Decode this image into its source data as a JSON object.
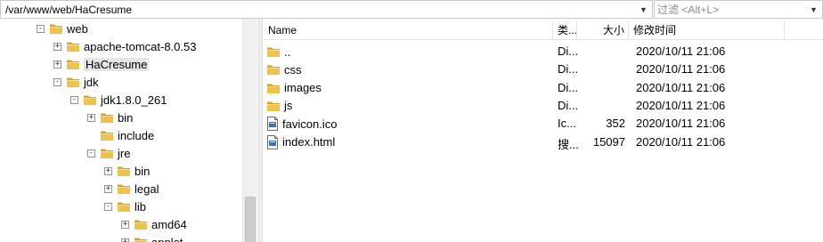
{
  "toolbar": {
    "path": "/var/www/web/HaCresume",
    "filter_placeholder": "过滤 <Alt+L>"
  },
  "tree": {
    "items": [
      {
        "label": "web",
        "expander": "-",
        "level": 2
      },
      {
        "label": "apache-tomcat-8.0.53",
        "expander": "+",
        "level": 3
      },
      {
        "label": "HaCresume",
        "expander": "+",
        "level": 3,
        "selected": true
      },
      {
        "label": "jdk",
        "expander": "-",
        "level": 3
      },
      {
        "label": "jdk1.8.0_261",
        "expander": "-",
        "level": 4
      },
      {
        "label": "bin",
        "expander": "+",
        "level": 5
      },
      {
        "label": "include",
        "expander": "",
        "level": 5
      },
      {
        "label": "jre",
        "expander": "-",
        "level": 5
      },
      {
        "label": "bin",
        "expander": "+",
        "level": 6
      },
      {
        "label": "legal",
        "expander": "+",
        "level": 6
      },
      {
        "label": "lib",
        "expander": "-",
        "level": 6
      },
      {
        "label": "amd64",
        "expander": "+",
        "level": 7
      },
      {
        "label": "applet",
        "expander": "+",
        "level": 7
      }
    ]
  },
  "filelist": {
    "headers": {
      "name": "Name",
      "type": "类...",
      "size": "大小",
      "modified": "修改时间"
    },
    "rows": [
      {
        "name": "..",
        "icon": "folder-icon",
        "type": "Di...",
        "size": "",
        "modified": "2020/10/11 21:06"
      },
      {
        "name": "css",
        "icon": "folder-icon",
        "type": "Di...",
        "size": "",
        "modified": "2020/10/11 21:06"
      },
      {
        "name": "images",
        "icon": "folder-icon",
        "type": "Di...",
        "size": "",
        "modified": "2020/10/11 21:06"
      },
      {
        "name": "js",
        "icon": "folder-icon",
        "type": "Di...",
        "size": "",
        "modified": "2020/10/11 21:06"
      },
      {
        "name": "favicon.ico",
        "icon": "file-icon",
        "type": "Ic...",
        "size": "352",
        "modified": "2020/10/11 21:06"
      },
      {
        "name": "index.html",
        "icon": "file-icon",
        "type": "搜...",
        "size": "15097",
        "modified": "2020/10/11 21:06"
      }
    ]
  },
  "colors": {
    "folder": "#f0c24b",
    "folder_dark": "#d9a22a",
    "selection": "#e5e5e5",
    "border": "#c9c9c9"
  }
}
